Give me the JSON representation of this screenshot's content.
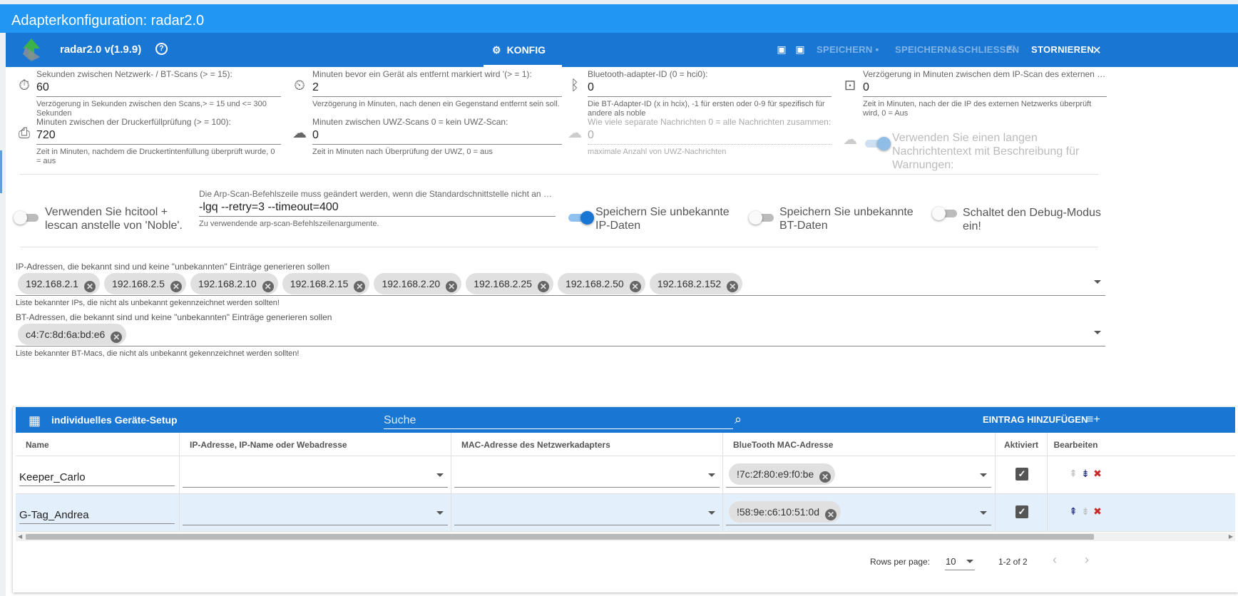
{
  "window": {
    "title": "Adapterkonfiguration: radar2.0"
  },
  "nav": {
    "adapter_name": "radar2.0 v(1.9.9)",
    "tab_label": "KONFIG",
    "save": "SPEICHERN",
    "save_close": "SPEICHERN&SCHLIESSEN",
    "cancel": "STORNIEREN"
  },
  "fields": {
    "scan_interval": {
      "label": "Sekunden zwischen Netzwerk- / BT-Scans (> = 15):",
      "value": "60",
      "hint": "Verzögerung in Sekunden zwischen den Scans,> = 15 und <= 300 Sekunden"
    },
    "remove_delay": {
      "label": "Minuten bevor ein Gerät als entfernt markiert wird '(> = 1):",
      "value": "2",
      "hint": "Verzögerung in Minuten, nach denen ein Gegenstand entfernt sein soll."
    },
    "bt_adapter": {
      "label": "Bluetooth-adapter-ID (0 = hci0):",
      "value": "0",
      "hint": "Die BT-Adapter-ID (x in hcix), -1 für ersten oder 0-9 für spezifisch für andere als noble"
    },
    "ext_ip_delay": {
      "label": "Verzögerung in Minuten zwischen dem IP-Scan des externen Netzwerks",
      "value": "0",
      "hint": "Zeit in Minuten, nach der die IP des externen Netzwerks überprüft wird, 0 = Aus"
    },
    "printer_delay": {
      "label": "Minuten zwischen der Druckerfüllprüfung (> = 100):",
      "value": "720",
      "hint": "Zeit in Minuten, nachdem die Druckertintenfüllung überprüft wurde, 0 = aus"
    },
    "uwz_delay": {
      "label": "Minuten zwischen UWZ-Scans 0 = kein UWZ-Scan:",
      "value": "0",
      "hint": "Zeit in Minuten nach Überprüfung der UWZ, 0 = aus"
    },
    "uwz_messages": {
      "label": "Wie viele separate Nachrichten 0 = alle Nachrichten zusammen:",
      "value": "0",
      "hint": "maximale Anzahl von UWZ-Nachrichten"
    },
    "arp_cmd": {
      "label": "Die Arp-Scan-Befehlszeile muss geändert werden, wenn die Standardschnittstelle nicht an erster Stelle...",
      "value": "-lgq --retry=3 --timeout=400",
      "hint": "Zu verwendende arp-scan-Befehlszeilenargumente."
    }
  },
  "switches": {
    "long_text": {
      "label": "Verwenden Sie einen langen Nachrichtentext mit Beschreibung für Warnungen:",
      "on": true,
      "disabled": true
    },
    "hcitool": {
      "label": "Verwenden Sie hcitool + lescan anstelle von 'Noble'.",
      "on": false
    },
    "unknown_ip": {
      "label": "Speichern Sie unbekannte IP-Daten",
      "on": true
    },
    "unknown_bt": {
      "label": "Speichern Sie unbekannte BT-Daten",
      "on": false
    },
    "debug": {
      "label": "Schaltet den Debug-Modus ein!",
      "on": false
    }
  },
  "known_ips": {
    "label": "IP-Adressen, die bekannt sind und keine \"unbekannten\" Einträge generieren sollen",
    "chips": [
      "192.168.2.1",
      "192.168.2.5",
      "192.168.2.10",
      "192.168.2.15",
      "192.168.2.20",
      "192.168.2.25",
      "192.168.2.50",
      "192.168.2.152"
    ],
    "hint": "Liste bekannter IPs, die nicht als unbekannt gekennzeichnet werden sollten!"
  },
  "known_bts": {
    "label": "BT-Adressen, die bekannt sind und keine \"unbekannten\" Einträge generieren sollen",
    "chips": [
      "c4:7c:8d:6a:bd:e6"
    ],
    "hint": "Liste bekannter BT-Macs, die nicht als unbekannt gekennzeichnet werden sollten!"
  },
  "table": {
    "title": "individuelles Geräte-Setup",
    "search_placeholder": "Suche",
    "add_label": "EINTRAG HINZUFÜGEN",
    "columns": [
      "Name",
      "IP-Adresse, IP-Name oder Webadresse",
      "MAC-Adresse des Netzwerkadapters",
      "BlueTooth MAC-Adresse",
      "Aktiviert",
      "Bearbeiten"
    ],
    "rows": [
      {
        "name": "Keeper_Carlo",
        "ip": "",
        "mac": "",
        "bt": "!7c:2f:80:e9:f0:be",
        "enabled": true
      },
      {
        "name": "G-Tag_Andrea",
        "ip": "",
        "mac": "",
        "bt": "!58:9e:c6:10:51:0d",
        "enabled": true
      }
    ],
    "rows_per_page_label": "Rows per page:",
    "rows_per_page": "10",
    "range": "1-2 of 2"
  },
  "colors": {
    "primary": "#1976d2",
    "title_bar": "#2196f3",
    "row_selected": "#e3f0fb"
  }
}
